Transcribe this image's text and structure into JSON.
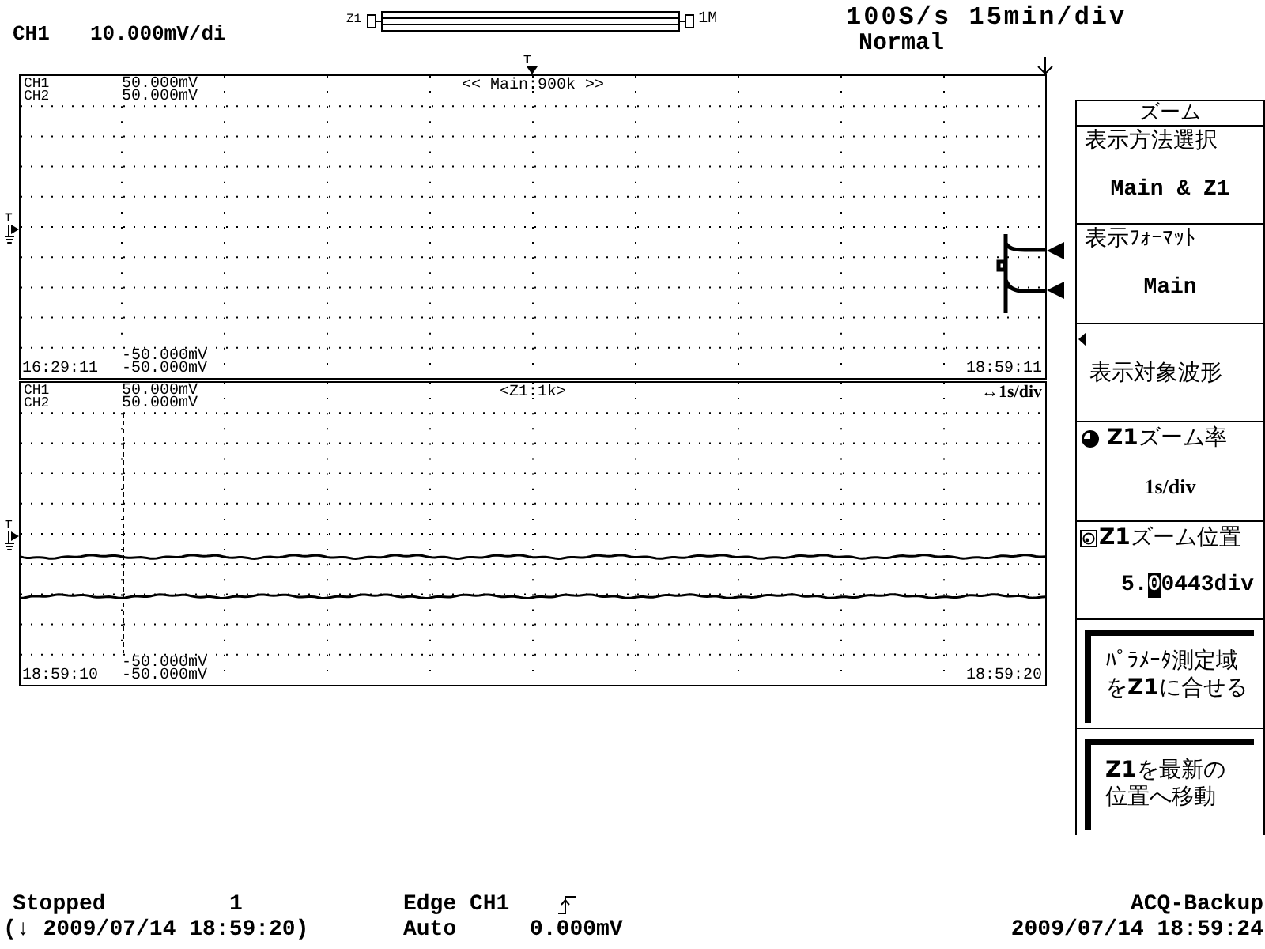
{
  "header": {
    "channel": "CH1",
    "scale": "10.000mV/di",
    "zoom_bar": {
      "left_label": "Z1",
      "right_label": "1M"
    },
    "timebase": "100S/s 15min/div",
    "acquisition_mode": "Normal",
    "trigger_position_label": "T"
  },
  "main_plot": {
    "title": "<< Main:900k >>",
    "channels": [
      "CH1",
      "CH2"
    ],
    "upper_limits": [
      "50.000mV",
      "50.000mV"
    ],
    "lower_limits": [
      "-50.000mV",
      "-50.000mV"
    ],
    "start_time": "16:29:11",
    "end_time": "18:59:11",
    "trigger_level_label": "T"
  },
  "zoom_plot": {
    "title": "<Z1:1k>",
    "time_div": "↔1s/div",
    "channels": [
      "CH1",
      "CH2"
    ],
    "upper_limits": [
      "50.000mV",
      "50.000mV"
    ],
    "lower_limits": [
      "-50.000mV",
      "-50.000mV"
    ],
    "start_time": "18:59:10",
    "end_time": "18:59:20",
    "trigger_level_label": "T"
  },
  "menu": {
    "title": "ズーム",
    "items": [
      {
        "kind": "select",
        "label": "表示方法選択",
        "value": "Main & Z1"
      },
      {
        "kind": "select",
        "label": "表示ﾌｫｰﾏｯﾄ",
        "value": "Main"
      },
      {
        "kind": "submenu",
        "label": "表示対象波形"
      },
      {
        "kind": "knob",
        "label": "**Z1**ズーム率",
        "value": "1s/div"
      },
      {
        "kind": "position",
        "label": "**Z1**ズーム位置",
        "value_parts": [
          {
            "text": "5.",
            "selected": false
          },
          {
            "text": "0",
            "selected": true
          },
          {
            "text": "0443div",
            "selected": false
          }
        ]
      },
      {
        "kind": "action",
        "lines": [
          "ﾊﾟﾗﾒｰﾀ測定域",
          "を**Z1**に合せる"
        ]
      },
      {
        "kind": "action",
        "lines": [
          "**Z1**を最新の",
          "位置へ移動"
        ]
      }
    ]
  },
  "status_bar": {
    "state": "Stopped",
    "count": "1",
    "stop_time": "(↓ 2009/07/14 18:59:20)",
    "trigger_type": "Edge CH1",
    "trigger_mode": "Auto",
    "trigger_level": "0.000mV",
    "backup": "ACQ-Backup",
    "datetime": "2009/07/14 18:59:24"
  }
}
